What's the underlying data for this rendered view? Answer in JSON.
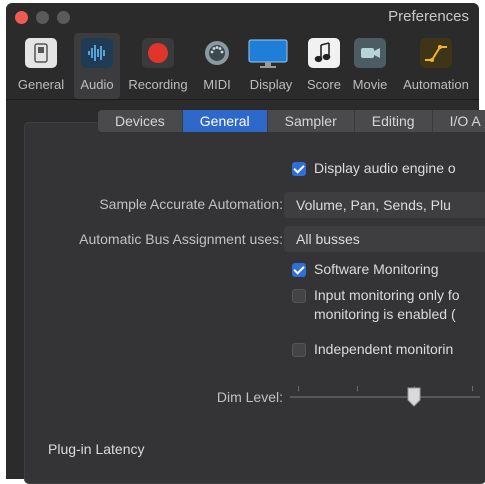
{
  "window": {
    "title": "Preferences"
  },
  "toolbar": {
    "items": [
      {
        "label": "General",
        "icon": "general-switch-icon"
      },
      {
        "label": "Audio",
        "icon": "audio-waveform-icon",
        "selected": true
      },
      {
        "label": "Recording",
        "icon": "record-icon"
      },
      {
        "label": "MIDI",
        "icon": "midi-connector-icon"
      },
      {
        "label": "Display",
        "icon": "display-monitor-icon"
      },
      {
        "label": "Score",
        "icon": "score-note-icon"
      },
      {
        "label": "Movie",
        "icon": "movie-camera-icon"
      },
      {
        "label": "Automation",
        "icon": "automation-curve-icon"
      }
    ]
  },
  "tabs": [
    {
      "label": "Devices"
    },
    {
      "label": "General",
      "active": true
    },
    {
      "label": "Sampler"
    },
    {
      "label": "Editing"
    },
    {
      "label": "I/O A"
    }
  ],
  "settings": {
    "display_engine": {
      "label": "Display audio engine o",
      "checked": true
    },
    "sample_accurate": {
      "label": "Sample Accurate Automation:",
      "value": "Volume, Pan, Sends, Plu"
    },
    "bus_assignment": {
      "label": "Automatic Bus Assignment uses:",
      "value": "All busses"
    },
    "software_monitoring": {
      "label": "Software Monitoring",
      "checked": true
    },
    "input_monitoring": {
      "label_line1": "Input monitoring only fo",
      "label_line2": "monitoring is enabled (",
      "checked": false
    },
    "independent_monitoring": {
      "label": "Independent monitorin",
      "checked": false
    },
    "dim_level": {
      "label": "Dim Level:",
      "level": 0.65
    }
  },
  "plugin_latency": {
    "title": "Plug-in Latency"
  },
  "colors": {
    "accent": "#2e6fd8",
    "tab_active": "#2e68c9",
    "close": "#ee5b52",
    "record": "#e0352b"
  }
}
